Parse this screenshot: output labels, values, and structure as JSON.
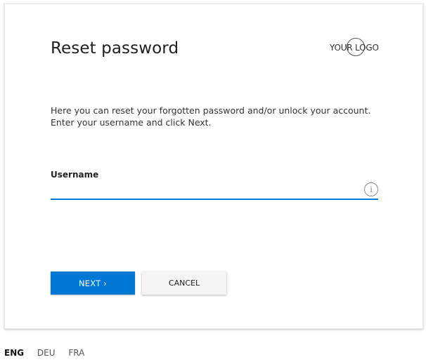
{
  "form": {
    "title": "Reset password",
    "logo_text": "YOUR LOGO",
    "description": [
      "Here you can reset your forgotten password and/or unlock your account.",
      "Enter your username and click Next."
    ],
    "username": {
      "label": "Username",
      "value": "",
      "placeholder": "",
      "info_icon": "i"
    },
    "next_label": "NEXT ›",
    "cancel_label": "CANCEL"
  },
  "languages": [
    {
      "code": "ENG",
      "active": true
    },
    {
      "code": "DEU",
      "active": false
    },
    {
      "code": "FRA",
      "active": false
    }
  ],
  "colors": {
    "accent": "#0078d4",
    "cancel_bg": "#f4f4f4"
  },
  "icons": {
    "info": "info-icon",
    "logo": "logo-circle-icon"
  }
}
